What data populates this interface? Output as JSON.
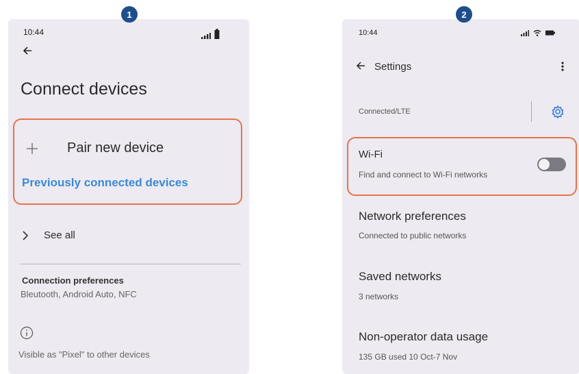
{
  "badges": [
    "1",
    "2"
  ],
  "phone1": {
    "status_time": "10:44",
    "title": "Connect devices",
    "pair_new_device": "Pair new device",
    "previously_connected": "Previously connected devices",
    "see_all": "See all",
    "connection_preferences_title": "Connection preferences",
    "connection_preferences_summary": "Bleutooth, Android Auto, NFC",
    "visible_as": "Visible as \"Pixel\" to other devices"
  },
  "phone2": {
    "status_time": "10:44",
    "header_title": "Settings",
    "connection_status": "Connected/LTE",
    "wifi_title": "Wi-Fi",
    "wifi_summary": "Find and connect to Wi-Fi networks",
    "wifi_enabled": false,
    "network_preferences_title": "Network preferences",
    "network_preferences_summary": "Connected to public networks",
    "saved_networks_title": "Saved networks",
    "saved_networks_summary": "3 networks",
    "data_usage_title": "Non-operator data usage",
    "data_usage_summary": "135 GB used 10 Oct-7 Nov"
  },
  "colors": {
    "highlight": "#e8724a",
    "link": "#3b8ad6",
    "badge": "#1f4e8c",
    "screen_bg": "#edeaf1"
  },
  "icons": [
    "back-arrow-icon",
    "signal-icon",
    "battery-icon",
    "wifi-icon",
    "plus-icon",
    "chevron-right-icon",
    "info-icon",
    "more-vert-icon",
    "settings-gear-icon"
  ]
}
